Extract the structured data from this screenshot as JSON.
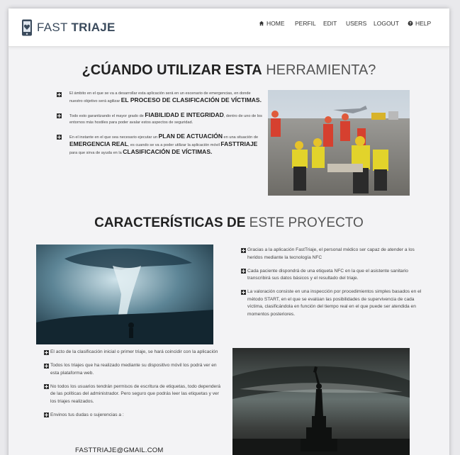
{
  "brand": {
    "name_light": "FAST",
    "name_bold": "TRIAJE"
  },
  "nav": {
    "items": [
      {
        "label": "HOME",
        "icon": "home-icon"
      },
      {
        "label": "PERFIL"
      },
      {
        "label": "EDIT"
      },
      {
        "label": "USERS"
      },
      {
        "label": "LOGOUT"
      },
      {
        "label": "HELP",
        "icon": "help-icon"
      }
    ]
  },
  "section1": {
    "title_strong": "¿CÚANDO UTILIZAR ESTA",
    "title_light": "HERRAMIENTA?",
    "bullets": [
      {
        "text": "El ámbito en el que se va a desarrollar esta aplicación será en un escenario de emergencias, en donde nuestro objetivo será agilizar ",
        "em": "EL PROCESO DE CLASIFICACIÓN DE VÍCTIMAS.",
        "after": ""
      },
      {
        "text": "Todo esto garantizando el mayor grado de ",
        "em": "FIABILIDAD E INTEGRIDAD",
        "after": ", dentro de uno de los entornos más hostiles para poder avalar estos aspectos de seguridad."
      },
      {
        "text": "En el instante en el que sea necesario ejecutar un ",
        "em": "PLAN DE ACTUACIÓN",
        "after": " en una situación de ",
        "em2": "EMERGENCIA REAL",
        "after2": ", es cuando se va a poder utilizar la aplicación móvil ",
        "em3": "FASTTRIAJE",
        "after3": " para que sirva de ayuda en la ",
        "em4": "CLASIFICACIÓN DE VÍCTIMAS."
      }
    ]
  },
  "section2": {
    "title_strong": "CARACTERÍSTICAS DE",
    "title_light": "ESTE PROYECTO",
    "right_paragraphs": [
      "Gracias a la aplicación FastTriaje, el personal médico ser capaz de atender a los heridos mediante la tecnología NFC",
      "Cada paciente dispondrá de una etiqueta NFC en la que el asistente sanitario transcribirá sus datos básicos y el resultado del triaje.",
      "La valoración consiste en una inspección por procedimientos simples basados en el método START, en el que se evalúan las posibilidades de supervivencia de cada víctima, clasificándola en función del tiempo real en el que puede ser atendida en momentos posteriores."
    ],
    "left_paragraphs": [
      "El acto de la clasificación inicial o primer triaje, se hará coincidir con la aplicación",
      "Todos los triajes que ha realizado mediante su dispositivo móvil los podrá ver en esta plataforma web.",
      "No todos los usuarios tendrán permisos de escritura de etiquetas, todo dependerá de las políticas del administrador. Pero seguro que podrás leer las etiquetas y ver los triajes realizados.",
      "Envinos tus dudas o sujerencias a :"
    ],
    "email": "FASTTRIAJE@GMAIL.COM"
  }
}
